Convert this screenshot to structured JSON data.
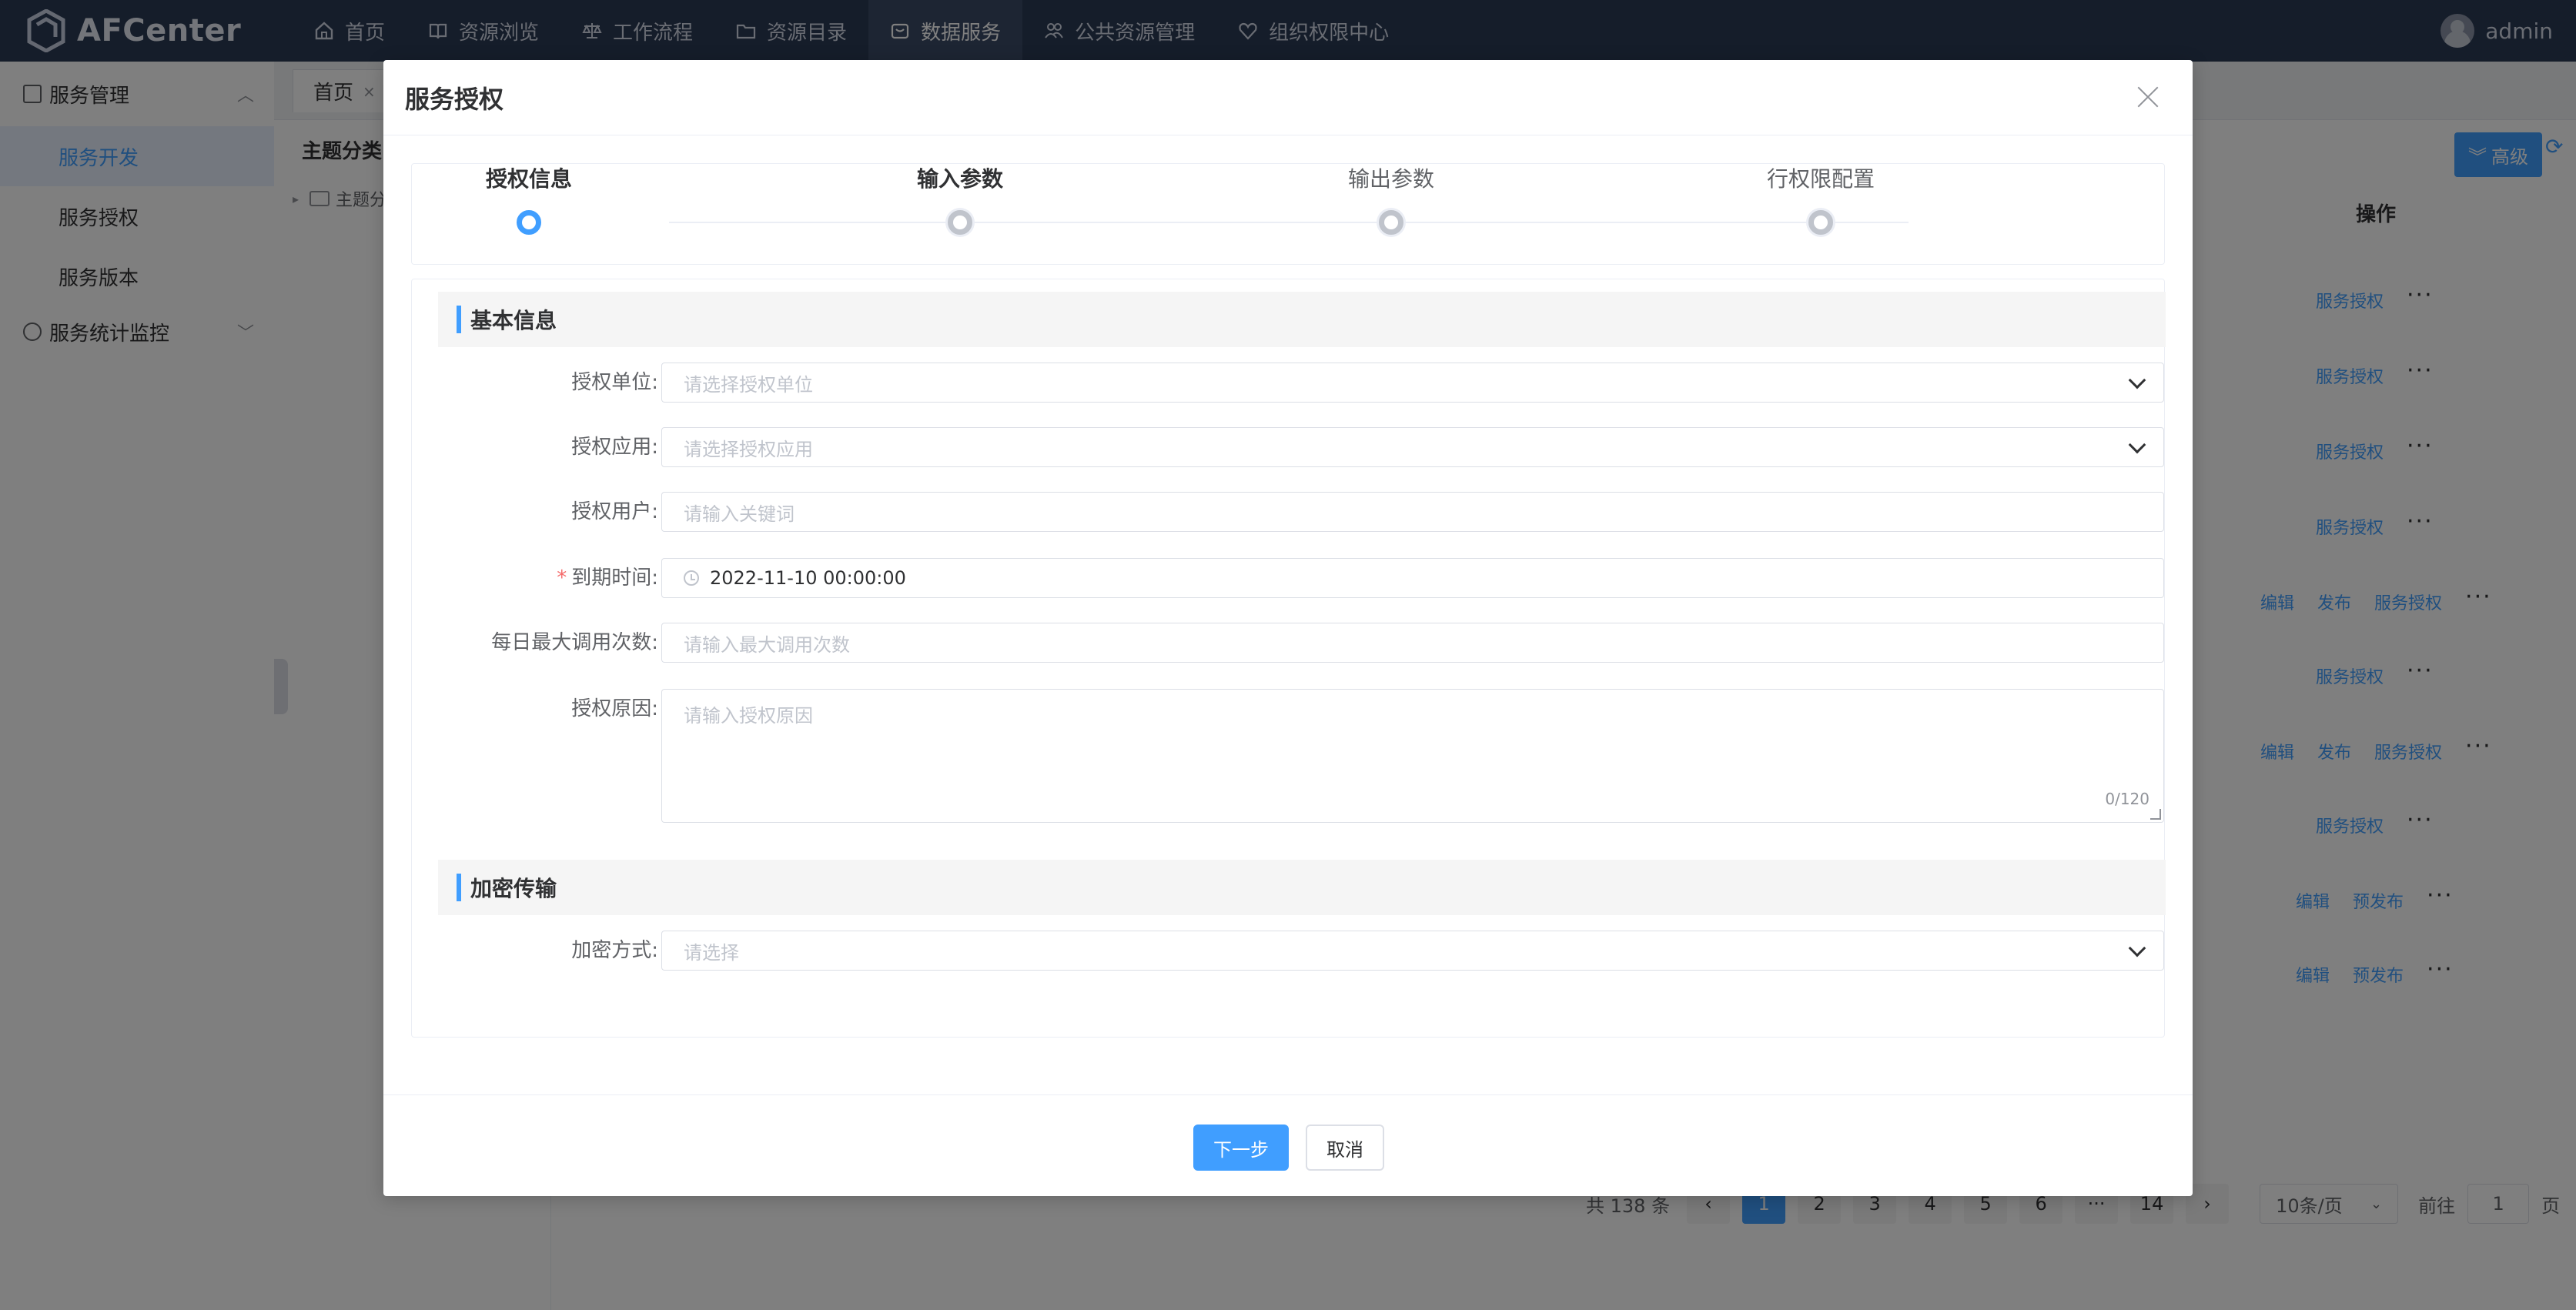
{
  "app": {
    "name": "AFCenter"
  },
  "nav": [
    {
      "label": "首页",
      "icon": "home-icon"
    },
    {
      "label": "资源浏览",
      "icon": "book-icon"
    },
    {
      "label": "工作流程",
      "icon": "scale-icon"
    },
    {
      "label": "资源目录",
      "icon": "folder-icon"
    },
    {
      "label": "数据服务",
      "icon": "data-service-icon",
      "active": true
    },
    {
      "label": "公共资源管理",
      "icon": "people-icon"
    },
    {
      "label": "组织权限中心",
      "icon": "shield-heart-icon"
    }
  ],
  "user": {
    "name": "admin"
  },
  "sidebar": {
    "group1": "服务管理",
    "items": [
      "服务开发",
      "服务授权",
      "服务版本"
    ],
    "group2": "服务统计监控"
  },
  "tabs": {
    "home": "首页"
  },
  "tree": {
    "title": "主题分类",
    "node": "主题分"
  },
  "list": {
    "advanced": "高级",
    "op_header": "操作",
    "rows": [
      [
        "服务授权"
      ],
      [
        "服务授权"
      ],
      [
        "服务授权"
      ],
      [
        "服务授权"
      ],
      [
        "编辑",
        "发布",
        "服务授权"
      ],
      [
        "服务授权"
      ],
      [
        "编辑",
        "发布",
        "服务授权"
      ],
      [
        "服务授权"
      ],
      [
        "编辑",
        "预发布"
      ],
      [
        "编辑",
        "预发布"
      ]
    ]
  },
  "pager": {
    "total": "共 138 条",
    "pages": [
      "1",
      "2",
      "3",
      "4",
      "5",
      "6",
      "···",
      "14"
    ],
    "size": "10条/页",
    "goto": "前往",
    "goto_value": "1",
    "page_unit": "页"
  },
  "modal": {
    "title": "服务授权",
    "steps": [
      "授权信息",
      "输入参数",
      "输出参数",
      "行权限配置"
    ],
    "section_basic": "基本信息",
    "section_encrypt": "加密传输",
    "fields": {
      "unit": {
        "label": "授权单位:",
        "placeholder": "请选择授权单位"
      },
      "app": {
        "label": "授权应用:",
        "placeholder": "请选择授权应用"
      },
      "user": {
        "label": "授权用户:",
        "placeholder": "请输入关键词"
      },
      "expire": {
        "label": "到期时间:",
        "value": "2022-11-10 00:00:00",
        "required_mark": "*"
      },
      "max_calls": {
        "label": "每日最大调用次数:",
        "placeholder": "请输入最大调用次数"
      },
      "reason": {
        "label": "授权原因:",
        "placeholder": "请输入授权原因",
        "counter": "0/120"
      },
      "encrypt": {
        "label": "加密方式:",
        "placeholder": "请选择"
      }
    },
    "buttons": {
      "next": "下一步",
      "cancel": "取消"
    }
  },
  "colors": {
    "primary": "#409eff",
    "topbar": "#2b3a55",
    "required": "#f56c6c"
  }
}
